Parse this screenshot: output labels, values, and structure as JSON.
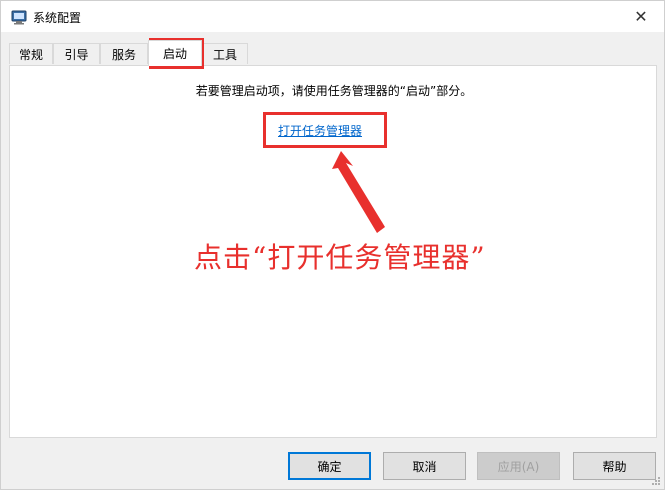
{
  "window": {
    "title": "系统配置",
    "app_icon": "msconfig-icon",
    "close_glyph": "✕"
  },
  "tabs": [
    {
      "label": "常规"
    },
    {
      "label": "引导"
    },
    {
      "label": "服务"
    },
    {
      "label": "启动",
      "active": true
    },
    {
      "label": "工具"
    }
  ],
  "panel": {
    "info_text": "若要管理启动项，请使用任务管理器的“启动”部分。",
    "link_text": "打开任务管理器"
  },
  "annotation": {
    "text": "点击“打开任务管理器”",
    "color": "#e8302d"
  },
  "buttons": {
    "ok": "确定",
    "cancel": "取消",
    "apply": "应用(A)",
    "help": "帮助"
  }
}
